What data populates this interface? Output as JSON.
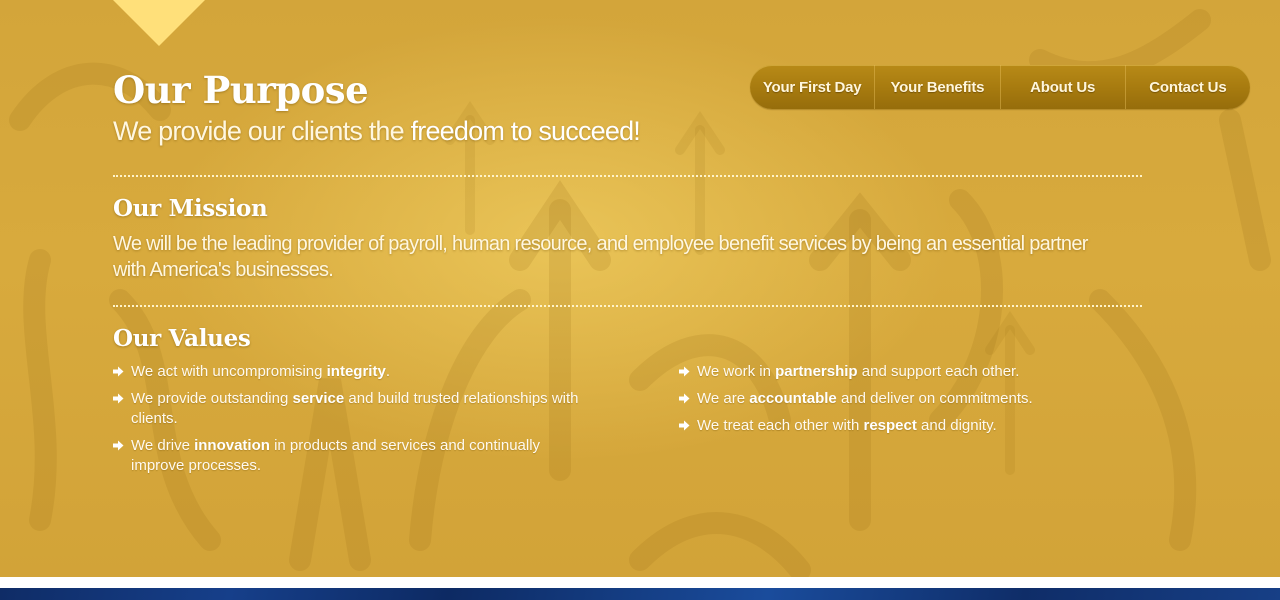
{
  "nav": {
    "items": [
      {
        "label": "Your First Day"
      },
      {
        "label": "Your Benefits"
      },
      {
        "label": "About Us"
      },
      {
        "label": "Contact Us"
      }
    ]
  },
  "purpose": {
    "title": "Our Purpose",
    "tagline_plain": "We provide our clients the ",
    "tagline_strong": "freedom to succeed!"
  },
  "mission": {
    "title": "Our Mission",
    "text": "We will be the leading provider of payroll, human resource, and employee benefit services by being an essential partner with America's businesses."
  },
  "values": {
    "title": "Our Values",
    "left": [
      {
        "before": "We act with uncompromising ",
        "bold": "integrity",
        "after": "."
      },
      {
        "before": "We provide outstanding ",
        "bold": "service",
        "after": " and build trusted relationships with clients."
      },
      {
        "before": "We drive ",
        "bold": "innovation",
        "after": " in products and services and continually improve processes."
      }
    ],
    "right": [
      {
        "before": "We work in ",
        "bold": "partnership",
        "after": " and support each other."
      },
      {
        "before": "We are ",
        "bold": "accountable",
        "after": " and deliver on commitments."
      },
      {
        "before": "We treat each other with ",
        "bold": "respect",
        "after": " and dignity."
      }
    ]
  },
  "icons": {
    "bullet": "arrow-right-icon",
    "top_marker": "triangle-down-icon"
  },
  "colors": {
    "background_gold": "#d6a83b",
    "nav_gold": "#a67a0f",
    "accent_yellow": "#ffe07a",
    "footer_blue": "#163f8a"
  }
}
